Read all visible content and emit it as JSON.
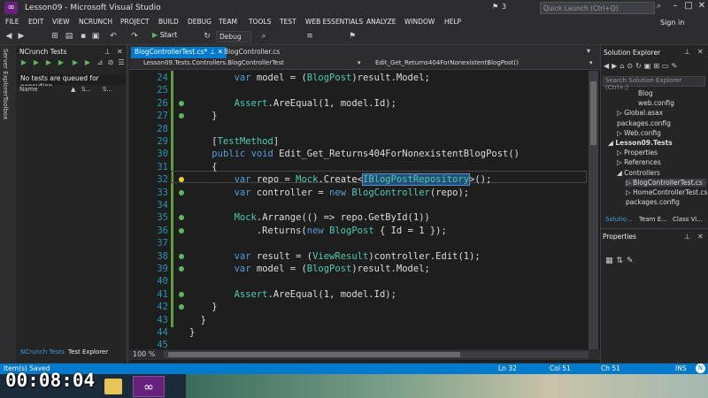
{
  "window": {
    "title": "Lesson09 - Microsoft Visual Studio",
    "notification_count": "3"
  },
  "quick_launch": {
    "placeholder": "Quick Launch (Ctrl+Q)"
  },
  "menu": [
    "FILE",
    "EDIT",
    "VIEW",
    "NCRUNCH",
    "PROJECT",
    "BUILD",
    "DEBUG",
    "TEAM",
    "TOOLS",
    "TEST",
    "WEB ESSENTIALS",
    "ANALYZE",
    "WINDOW",
    "HELP"
  ],
  "sign_in": "Sign in",
  "toolbar": {
    "start_label": "Start",
    "configuration": "Debug"
  },
  "side_tabs": [
    "Server Explorer",
    "Toolbox"
  ],
  "ncrunch": {
    "title": "NCrunch Tests",
    "message": "No tests are queued for execution.",
    "columns": [
      "Name",
      "S...",
      "S..."
    ],
    "bottom_tabs": [
      "NCrunch Tests",
      "Test Explorer"
    ]
  },
  "editor": {
    "tabs": [
      "BlogControllerTest.cs*",
      "BlogController.cs"
    ],
    "nav_class": "Lesson09.Tests.Controllers.BlogControllerTest",
    "nav_method": "Edit_Get_Returns404ForNonexistentBlogPost()",
    "zoom": "100 %",
    "lines": [
      {
        "n": "24",
        "t": "        var model = (BlogPost)result.Model;"
      },
      {
        "n": "25",
        "t": ""
      },
      {
        "n": "26",
        "t": "        Assert.AreEqual(1, model.Id);"
      },
      {
        "n": "27",
        "t": "    }"
      },
      {
        "n": "28",
        "t": ""
      },
      {
        "n": "29",
        "t": "    [TestMethod]"
      },
      {
        "n": "30",
        "t": "    public void Edit_Get_Returns404ForNonexistentBlogPost()"
      },
      {
        "n": "31",
        "t": "    {"
      },
      {
        "n": "32",
        "t": "        var repo = Mock.Create<IBlogPostRepository>();"
      },
      {
        "n": "33",
        "t": "        var controller = new BlogController(repo);"
      },
      {
        "n": "34",
        "t": ""
      },
      {
        "n": "35",
        "t": "        Mock.Arrange(() => repo.GetById(1))"
      },
      {
        "n": "36",
        "t": "            .Returns(new BlogPost { Id = 1 });"
      },
      {
        "n": "37",
        "t": ""
      },
      {
        "n": "38",
        "t": "        var result = (ViewResult)controller.Edit(1);"
      },
      {
        "n": "39",
        "t": "        var model = (BlogPost)result.Model;"
      },
      {
        "n": "40",
        "t": ""
      },
      {
        "n": "41",
        "t": "        Assert.AreEqual(1, model.Id);"
      },
      {
        "n": "42",
        "t": "    }"
      },
      {
        "n": "43",
        "t": "  }"
      },
      {
        "n": "44",
        "t": "}"
      },
      {
        "n": "45",
        "t": ""
      }
    ]
  },
  "solution_explorer": {
    "title": "Solution Explorer",
    "search_placeholder": "Search Solution Explorer (Ctrl+;)",
    "items": [
      "Blog",
      "web.config",
      "Global.asax",
      "packages.config",
      "Web.config",
      "Lesson09.Tests",
      "Properties",
      "References",
      "Controllers",
      "BlogControllerTest.cs",
      "HomeControllerTest.cs",
      "packages.config"
    ],
    "bottom_tabs": [
      "Solutio...",
      "Team E...",
      "Class Vi..."
    ]
  },
  "properties": {
    "title": "Properties"
  },
  "status": {
    "left": "Item(s) Saved",
    "ln": "Ln 32",
    "col": "Col 51",
    "ch": "Ch 51",
    "mode": "INS"
  },
  "overlay": {
    "timer": "00:08:04"
  },
  "colors": {
    "accent": "#007acc",
    "vs_purple": "#68217a",
    "change_bar": "#5c9c3c"
  }
}
